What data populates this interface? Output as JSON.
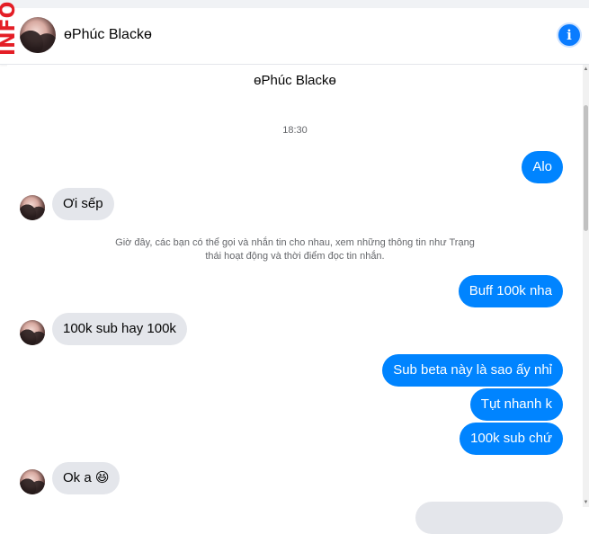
{
  "header": {
    "info_tag": "INFO",
    "contact_name": "ɵPhúc Blackɵ",
    "info_icon": "i"
  },
  "chat": {
    "title": "ɵPhúc Blackɵ",
    "timestamp": "18:30",
    "notice": "Giờ đây, các bạn có thể gọi và nhắn tin cho nhau, xem những thông tin như Trạng thái hoạt động và thời điểm đọc tin nhắn.",
    "messages": [
      {
        "from": "me",
        "text": "Alo"
      },
      {
        "from": "them",
        "text": "Ơi sếp"
      },
      {
        "from": "me",
        "text": "Buff 100k nha"
      },
      {
        "from": "them",
        "text": "100k sub hay 100k"
      },
      {
        "from": "me",
        "text": "Sub beta này là sao ấy nhỉ"
      },
      {
        "from": "me",
        "text": "Tụt nhanh k"
      },
      {
        "from": "me",
        "text": "100k sub chứ"
      },
      {
        "from": "them",
        "text": "Ok a 😆"
      }
    ]
  },
  "colors": {
    "outgoing_bubble": "#0084ff",
    "incoming_bubble": "#e4e6eb",
    "info_icon": "#0a7cff",
    "info_tag": "#e41e26"
  },
  "icons": {
    "info": "info-icon",
    "scroll_up": "scroll-up-arrow",
    "scroll_down": "scroll-down-arrow"
  }
}
